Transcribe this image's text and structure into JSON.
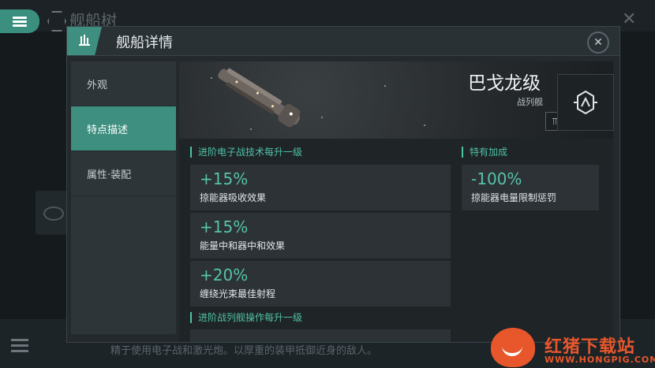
{
  "background": {
    "title": "舰船树",
    "bottom_text": "精于使用电子战和激光炮。以厚重的装甲抵御近身的敌人。"
  },
  "watermark": {
    "name": "红猪下载站",
    "url": "WWW.HONGPIG.COM"
  },
  "panel": {
    "title": "舰船详情",
    "close_icon": "close-icon"
  },
  "sidebar": {
    "items": [
      {
        "label": "外观",
        "active": false
      },
      {
        "label": "特点描述",
        "active": true
      },
      {
        "label": "属性·装配",
        "active": false
      }
    ]
  },
  "ship": {
    "name": "巴戈龙级",
    "class": "战列舰",
    "role_icons": [
      "turret-icon",
      "launcher-icon",
      "drone-icon"
    ]
  },
  "sections": {
    "skill_a": {
      "header": "进阶电子战技术每升一级",
      "bonuses": [
        {
          "value": "+15%",
          "desc": "掠能器吸收效果"
        },
        {
          "value": "+15%",
          "desc": "能量中和器中和效果"
        },
        {
          "value": "+20%",
          "desc": "缠绕光束最佳射程"
        }
      ]
    },
    "skill_b": {
      "header": "进阶战列舰操作每升一级"
    },
    "special": {
      "header": "特有加成",
      "bonuses": [
        {
          "value": "-100%",
          "desc": "掠能器电量限制惩罚"
        }
      ]
    }
  },
  "colors": {
    "accent": "#3e8f80",
    "bonus_text": "#57c2a8",
    "watermark": "#e8572c"
  }
}
